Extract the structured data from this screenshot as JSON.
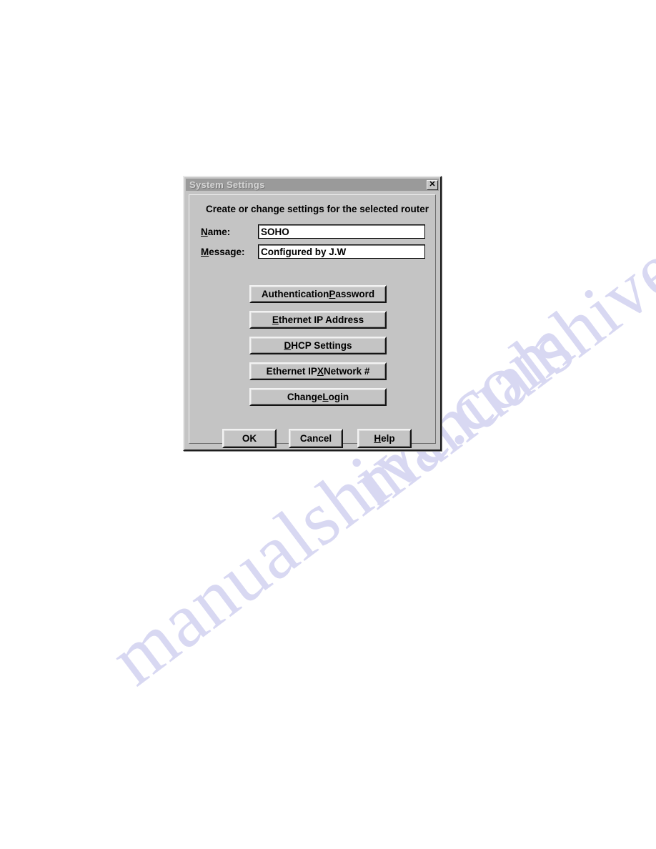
{
  "page": {
    "background_color": "#ffffff",
    "watermark_text": "manualshive.com",
    "watermark_color": "#d8d8f2"
  },
  "dialog": {
    "title": "System Settings",
    "close_icon": "close-x-icon",
    "close_label": "✕",
    "heading": "Create or change settings for the selected router",
    "background_color": "#c4c4c4",
    "titlebar_color": "#9a9a9a",
    "titlebar_text_color": "#d4d4d4",
    "fields": [
      {
        "label_prefix": "",
        "label_accel": "N",
        "label_suffix": "ame:",
        "value": "SOHO",
        "placeholder": ""
      },
      {
        "label_prefix": "",
        "label_accel": "M",
        "label_suffix": "essage:",
        "value": "Configured by J.W",
        "placeholder": ""
      }
    ],
    "stack_buttons": [
      {
        "pre": "Authentication ",
        "accel": "P",
        "post": "assword"
      },
      {
        "pre": "",
        "accel": "E",
        "post": "thernet IP Address"
      },
      {
        "pre": "",
        "accel": "D",
        "post": "HCP Settings"
      },
      {
        "pre": "Ethernet IP",
        "accel": "X",
        "post": " Network #"
      },
      {
        "pre": "Change ",
        "accel": "L",
        "post": "ogin"
      }
    ],
    "footer_buttons": [
      {
        "pre": "OK",
        "accel": "",
        "post": ""
      },
      {
        "pre": "Cancel",
        "accel": "",
        "post": ""
      },
      {
        "pre": "",
        "accel": "H",
        "post": "elp"
      }
    ]
  }
}
